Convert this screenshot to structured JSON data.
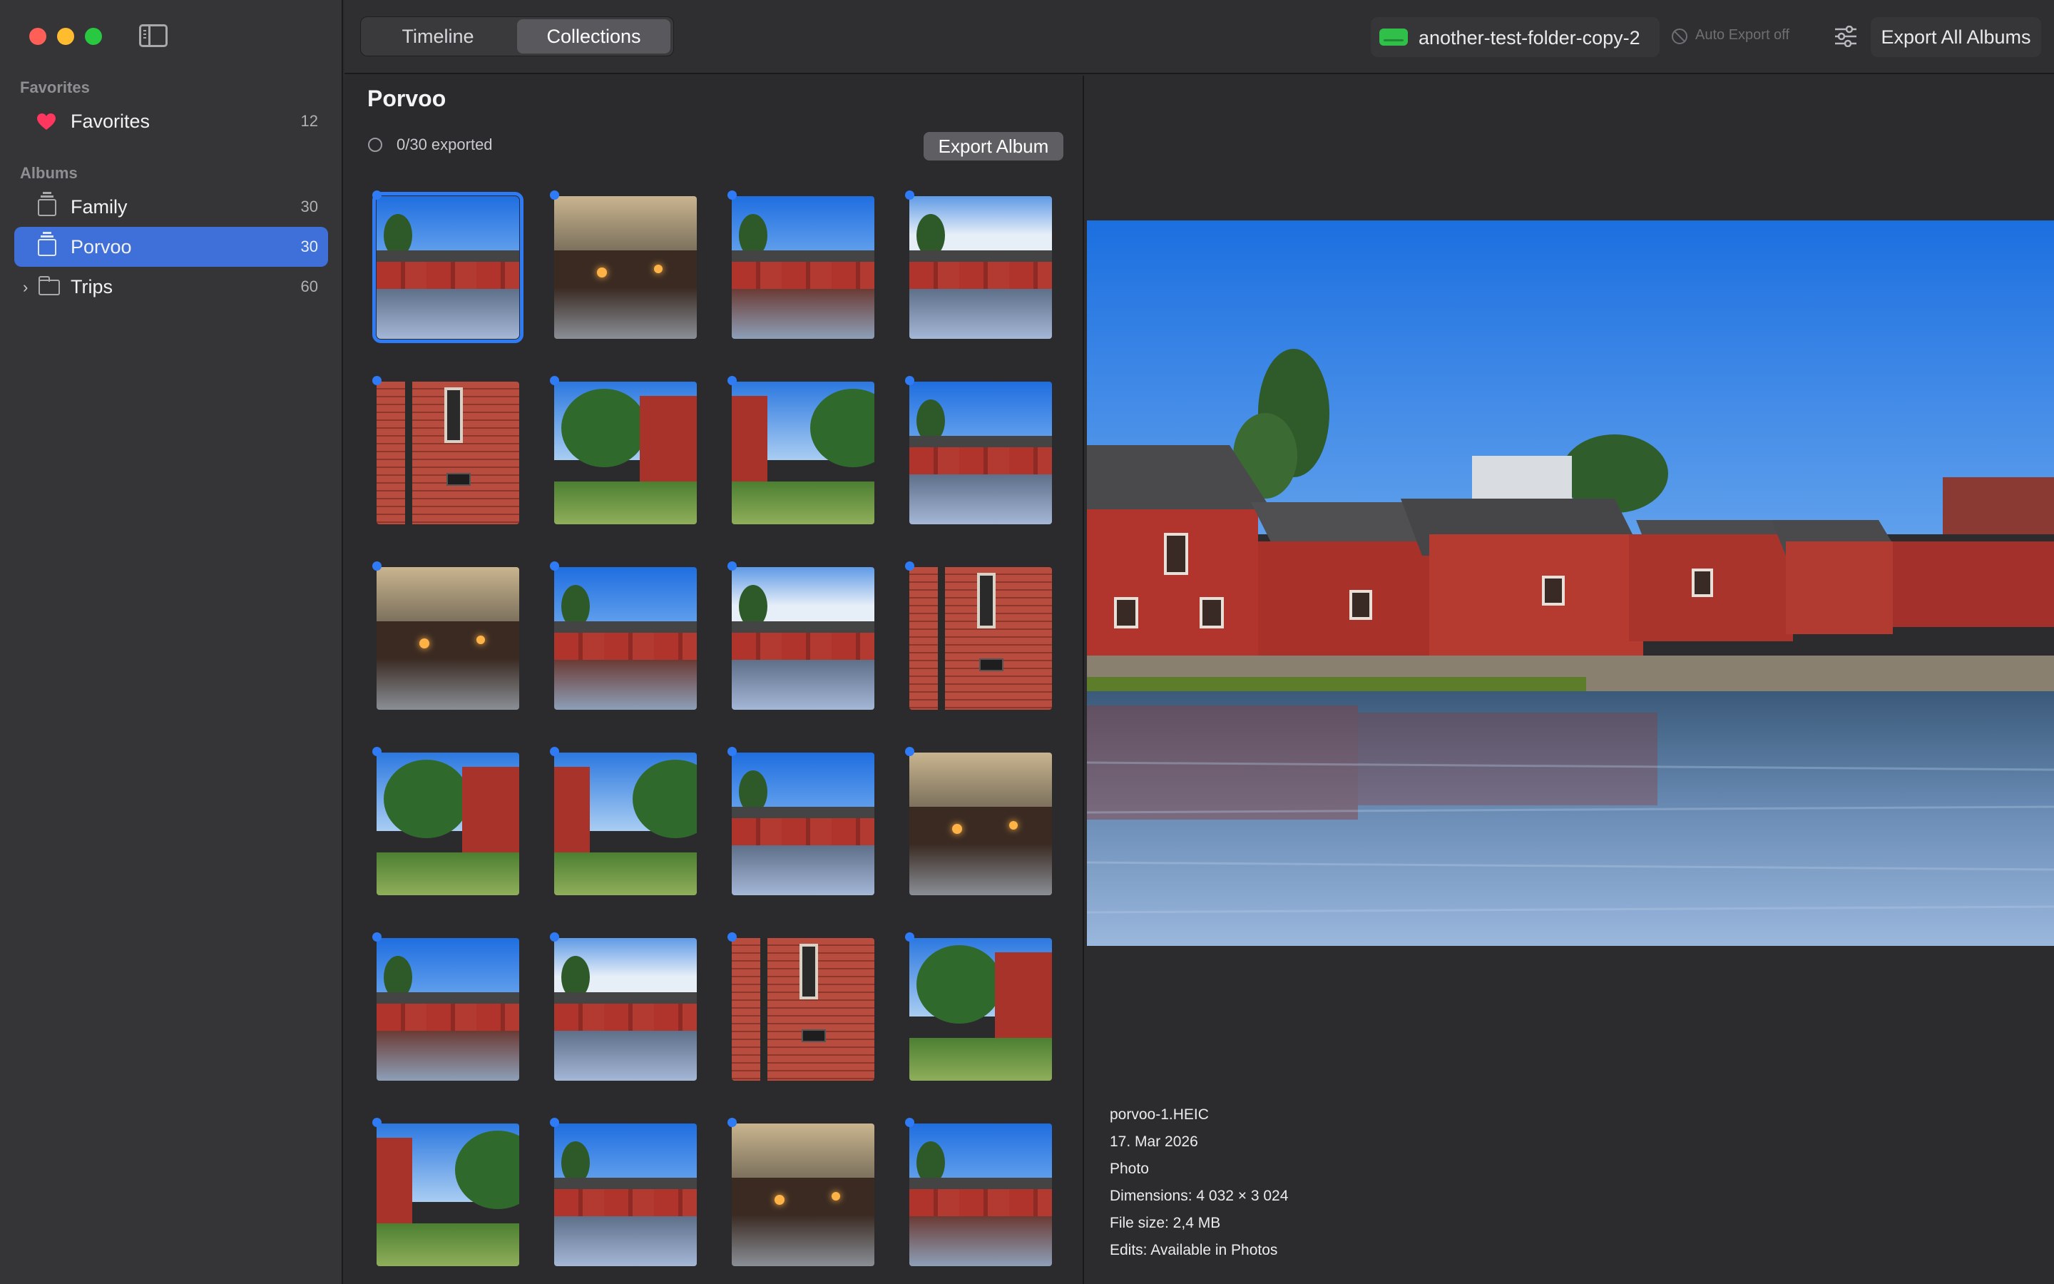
{
  "sidebar": {
    "favorites_header": "Favorites",
    "albums_header": "Albums",
    "favorites": {
      "label": "Favorites",
      "count": "12"
    },
    "albums": [
      {
        "label": "Family",
        "count": "30",
        "icon": "album-stack-icon",
        "selected": false
      },
      {
        "label": "Porvoo",
        "count": "30",
        "icon": "album-stack-icon",
        "selected": true
      },
      {
        "label": "Trips",
        "count": "60",
        "icon": "folder-icon",
        "selected": false
      }
    ]
  },
  "toolbar": {
    "tabs": [
      {
        "label": "Timeline",
        "active": false
      },
      {
        "label": "Collections",
        "active": true
      }
    ],
    "folder_name": "another-test-folder-copy-2",
    "auto_export": "Auto Export off",
    "export_all": "Export All Albums"
  },
  "album": {
    "title": "Porvoo",
    "export_status": "0/30 exported",
    "export_button": "Export Album",
    "thumbnails": [
      "river",
      "dusk",
      "town",
      "wide",
      "wall",
      "path",
      "side",
      "river",
      "dusk",
      "town",
      "wide",
      "wall",
      "path",
      "side",
      "river",
      "dusk",
      "town",
      "wide",
      "wall",
      "path",
      "side",
      "river",
      "dusk",
      "town"
    ],
    "selected_index": 0
  },
  "preview": {
    "filename": "porvoo-1.HEIC",
    "date": "17. Mar 2026",
    "kind": "Photo",
    "dimensions": "Dimensions: 4 032 × 3 024",
    "file_size": "File size: 2,4 MB",
    "edits": "Edits: Available in Photos"
  },
  "colors": {
    "accent": "#3f6fd8",
    "selection_dot": "#2f7bf6",
    "drive_green": "#30c04a",
    "favorite_red": "#ff375f"
  }
}
